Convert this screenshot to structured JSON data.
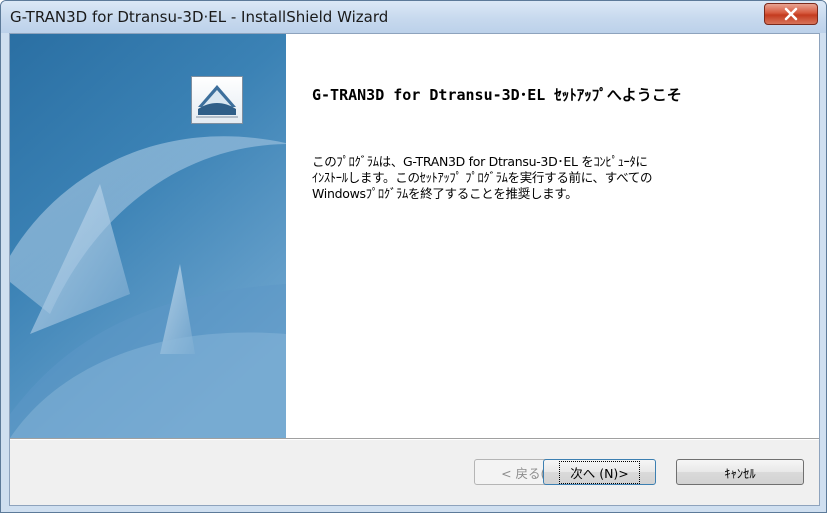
{
  "window": {
    "title": "G-TRAN3D for Dtransu-3D·EL - InstallShield Wizard",
    "close_label": "X"
  },
  "main": {
    "heading": "G-TRAN3D for Dtransu-3D･EL ｾｯﾄｱｯﾌﾟへようこそ",
    "body_lines": [
      "このﾌﾟﾛｸﾞﾗﾑは、G-TRAN3D for Dtransu-3D･EL をｺﾝﾋﾟｭｰﾀに",
      "ｲﾝｽﾄｰﾙします。このｾｯﾄｱｯﾌﾟ ﾌﾟﾛｸﾞﾗﾑを実行する前に、すべての",
      "Windowsﾌﾟﾛｸﾞﾗﾑを終了することを推奨します。"
    ]
  },
  "buttons": {
    "back": "< 戻る(B)",
    "next": "次へ (N)>",
    "cancel": "ｷｬﾝｾﾙ"
  },
  "icons": {
    "close": "close-icon",
    "logo": "installshield-logo-icon"
  },
  "colors": {
    "titlebar": "#c7d9ee",
    "left_panel": "#1f5d8f",
    "close_button": "#c43b1f"
  }
}
